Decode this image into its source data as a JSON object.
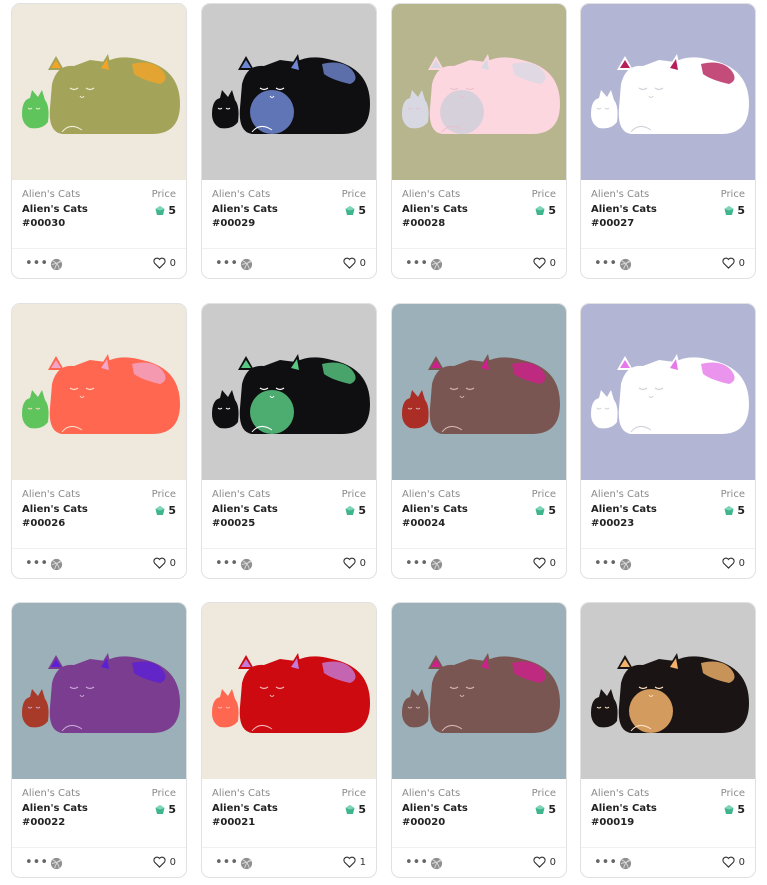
{
  "price_label": "Price",
  "cards": [
    {
      "collection": "Alien's Cats",
      "name": "Alien's Cats",
      "number": "#00030",
      "price": "5",
      "likes": "0",
      "bg": "#efe8dd",
      "big": "#a3a45a",
      "ear": "#f2a427",
      "small": "#5fc45c",
      "belly": "",
      "line": "#f0efd8"
    },
    {
      "collection": "Alien's Cats",
      "name": "Alien's Cats",
      "number": "#00029",
      "price": "5",
      "likes": "0",
      "bg": "#cbcbcb",
      "big": "#0f0f12",
      "ear": "#6f87d2",
      "small": "#0f0f12",
      "belly": "#6f87d2",
      "line": "#ffffff"
    },
    {
      "collection": "Alien's Cats",
      "name": "Alien's Cats",
      "number": "#00028",
      "price": "5",
      "likes": "0",
      "bg": "#b6b58e",
      "big": "#fcd7e0",
      "ear": "#d8d8e2",
      "small": "#d8d8e2",
      "belly": "#cfcfd9",
      "line": "#e8c2cc"
    },
    {
      "collection": "Alien's Cats",
      "name": "Alien's Cats",
      "number": "#00027",
      "price": "5",
      "likes": "0",
      "bg": "#b2b6d4",
      "big": "#ffffff",
      "ear": "#b51f5a",
      "small": "#ffffff",
      "belly": "",
      "line": "#d0d0d8"
    },
    {
      "collection": "Alien's Cats",
      "name": "Alien's Cats",
      "number": "#00026",
      "price": "5",
      "likes": "0",
      "bg": "#efe8dd",
      "big": "#ff6750",
      "ear": "#f3a6c8",
      "small": "#5fc45c",
      "belly": "",
      "line": "#ffd9c8"
    },
    {
      "collection": "Alien's Cats",
      "name": "Alien's Cats",
      "number": "#00025",
      "price": "5",
      "likes": "0",
      "bg": "#cbcbcb",
      "big": "#0f0f12",
      "ear": "#58c983",
      "small": "#0f0f12",
      "belly": "#58c983",
      "line": "#ffffff"
    },
    {
      "collection": "Alien's Cats",
      "name": "Alien's Cats",
      "number": "#00024",
      "price": "5",
      "likes": "0",
      "bg": "#9bb0b8",
      "big": "#7a5652",
      "ear": "#cf1f8c",
      "small": "#aa2d26",
      "belly": "",
      "line": "#d5b4ad"
    },
    {
      "collection": "Alien's Cats",
      "name": "Alien's Cats",
      "number": "#00023",
      "price": "5",
      "likes": "0",
      "bg": "#b2b6d4",
      "big": "#ffffff",
      "ear": "#e679e9",
      "small": "#ffffff",
      "belly": "",
      "line": "#d0d0d8"
    },
    {
      "collection": "Alien's Cats",
      "name": "Alien's Cats",
      "number": "#00022",
      "price": "5",
      "likes": "0",
      "bg": "#9bb0b8",
      "big": "#7a3d90",
      "ear": "#5b1fd6",
      "small": "#a83a2a",
      "belly": "",
      "line": "#c7a8d4"
    },
    {
      "collection": "Alien's Cats",
      "name": "Alien's Cats",
      "number": "#00021",
      "price": "5",
      "likes": "1",
      "bg": "#efe8dd",
      "big": "#cc0a10",
      "ear": "#c37ad8",
      "small": "#ff6750",
      "belly": "",
      "line": "#f5b8b8"
    },
    {
      "collection": "Alien's Cats",
      "name": "Alien's Cats",
      "number": "#00020",
      "price": "5",
      "likes": "0",
      "bg": "#9bb0b8",
      "big": "#7a5652",
      "ear": "#cf1f8c",
      "small": "#7a5652",
      "belly": "",
      "line": "#d5b4ad"
    },
    {
      "collection": "Alien's Cats",
      "name": "Alien's Cats",
      "number": "#00019",
      "price": "5",
      "likes": "0",
      "bg": "#cbcbcb",
      "big": "#1a1414",
      "ear": "#f4b36a",
      "small": "#1a1414",
      "belly": "#f4b36a",
      "line": "#ffe3c4"
    }
  ]
}
